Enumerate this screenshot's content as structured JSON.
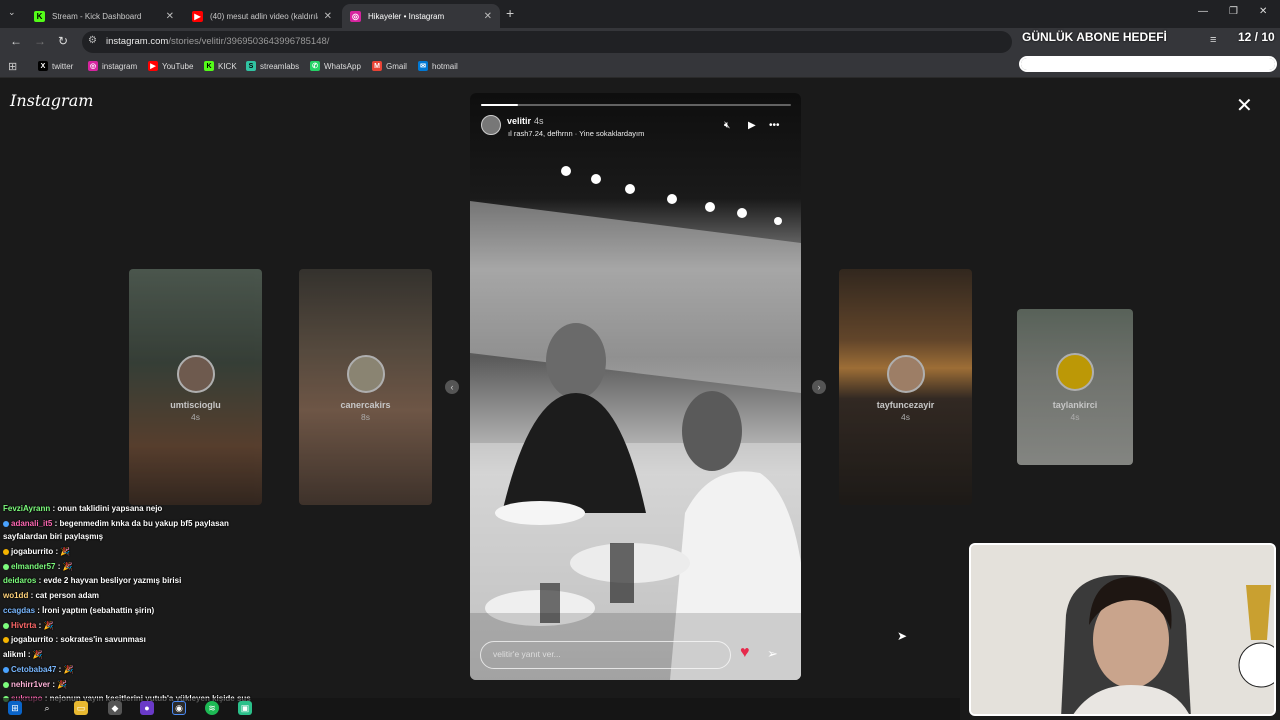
{
  "browser": {
    "tabs": [
      {
        "title": "Stream - Kick Dashboard",
        "icon": "kick-icon",
        "color": "#53fc18",
        "glyph": "K"
      },
      {
        "title": "(40) mesut adlin video (kaldırıla",
        "icon": "youtube-icon",
        "color": "#ff0000",
        "glyph": "▶"
      },
      {
        "title": "Hikayeler • Instagram",
        "icon": "instagram-icon",
        "color": "#d6249f",
        "glyph": "◎"
      }
    ],
    "url_host": "instagram.com",
    "url_path": "/stories/velitir/3969503643996785148/",
    "bookmarks": [
      {
        "label": "twitter",
        "icon": "x-icon",
        "color": "#000000",
        "glyph": "X"
      },
      {
        "label": "instagram",
        "icon": "instagram-icon",
        "color": "#d6249f",
        "glyph": "◎"
      },
      {
        "label": "YouTube",
        "icon": "youtube-icon",
        "color": "#ff0000",
        "glyph": "▶"
      },
      {
        "label": "KICK",
        "icon": "kick-icon",
        "color": "#53fc18",
        "glyph": "K"
      },
      {
        "label": "streamlabs",
        "icon": "streamlabs-icon",
        "color": "#31c3a2",
        "glyph": "S"
      },
      {
        "label": "WhatsApp",
        "icon": "whatsapp-icon",
        "color": "#25d366",
        "glyph": "✆"
      },
      {
        "label": "Gmail",
        "icon": "gmail-icon",
        "color": "#ea4335",
        "glyph": "M"
      },
      {
        "label": "hotmail",
        "icon": "hotmail-icon",
        "color": "#0078d4",
        "glyph": "✉"
      }
    ]
  },
  "overlay": {
    "goal_title": "GÜNLÜK ABONE HEDEFİ",
    "goal_count": "12 / 10",
    "goal_progress": 1.0
  },
  "instagram": {
    "logo": "Instagram",
    "main_story": {
      "username": "velitir",
      "time": "4s",
      "music": "rash7.24, defhrnn · Yine sokaklardayım",
      "progress": 0.12,
      "reply_placeholder": "velitir'e yanıt ver..."
    },
    "side_stories": [
      {
        "username": "umtiscioglu",
        "time": "4s"
      },
      {
        "username": "canercakirs",
        "time": "8s"
      },
      {
        "username": "tayfuncezayir",
        "time": "4s"
      },
      {
        "username": "taylankirci",
        "time": "4s"
      }
    ]
  },
  "chat": [
    {
      "user": "FevziAyrann",
      "color": "#7cfc7c",
      "text": "onun taklidini yapsana nejo"
    },
    {
      "user": "adanali_it5",
      "color": "#ff69b4",
      "text": "begenmedim knka da bu yakup bf5 paylasan"
    },
    {
      "user": "",
      "color": "#ffffff",
      "text": "sayfalardan biri paylaşmış"
    },
    {
      "user": "jogaburrito",
      "color": "#ffffff",
      "text": "🎉"
    },
    {
      "user": "elmander57",
      "color": "#7cfc7c",
      "text": "🎉"
    },
    {
      "user": "deidaros",
      "color": "#7cfc7c",
      "text": "evde 2 hayvan besliyor yazmış birisi"
    },
    {
      "user": "wo1dd",
      "color": "#ffd27a",
      "text": "cat person adam"
    },
    {
      "user": "ccagdas",
      "color": "#7ab8ff",
      "text": "İroni yaptım (sebahattin şirin)"
    },
    {
      "user": "Hivtrta",
      "color": "#ff6a6a",
      "text": "🎉"
    },
    {
      "user": "jogaburrito",
      "color": "#ffffff",
      "text": "sokrates'in savunması"
    },
    {
      "user": "alikml",
      "color": "#ffffff",
      "text": "🎉"
    },
    {
      "user": "Cetobaba47",
      "color": "#7ab8ff",
      "text": "🎉"
    },
    {
      "user": "nehirr1ver",
      "color": "#ffb3d9",
      "text": "🎉"
    },
    {
      "user": "sukrupo",
      "color": "#ff69b4",
      "text": "nejonun yayın kesitlerini yutub'a yükleyen kişide sus"
    }
  ]
}
